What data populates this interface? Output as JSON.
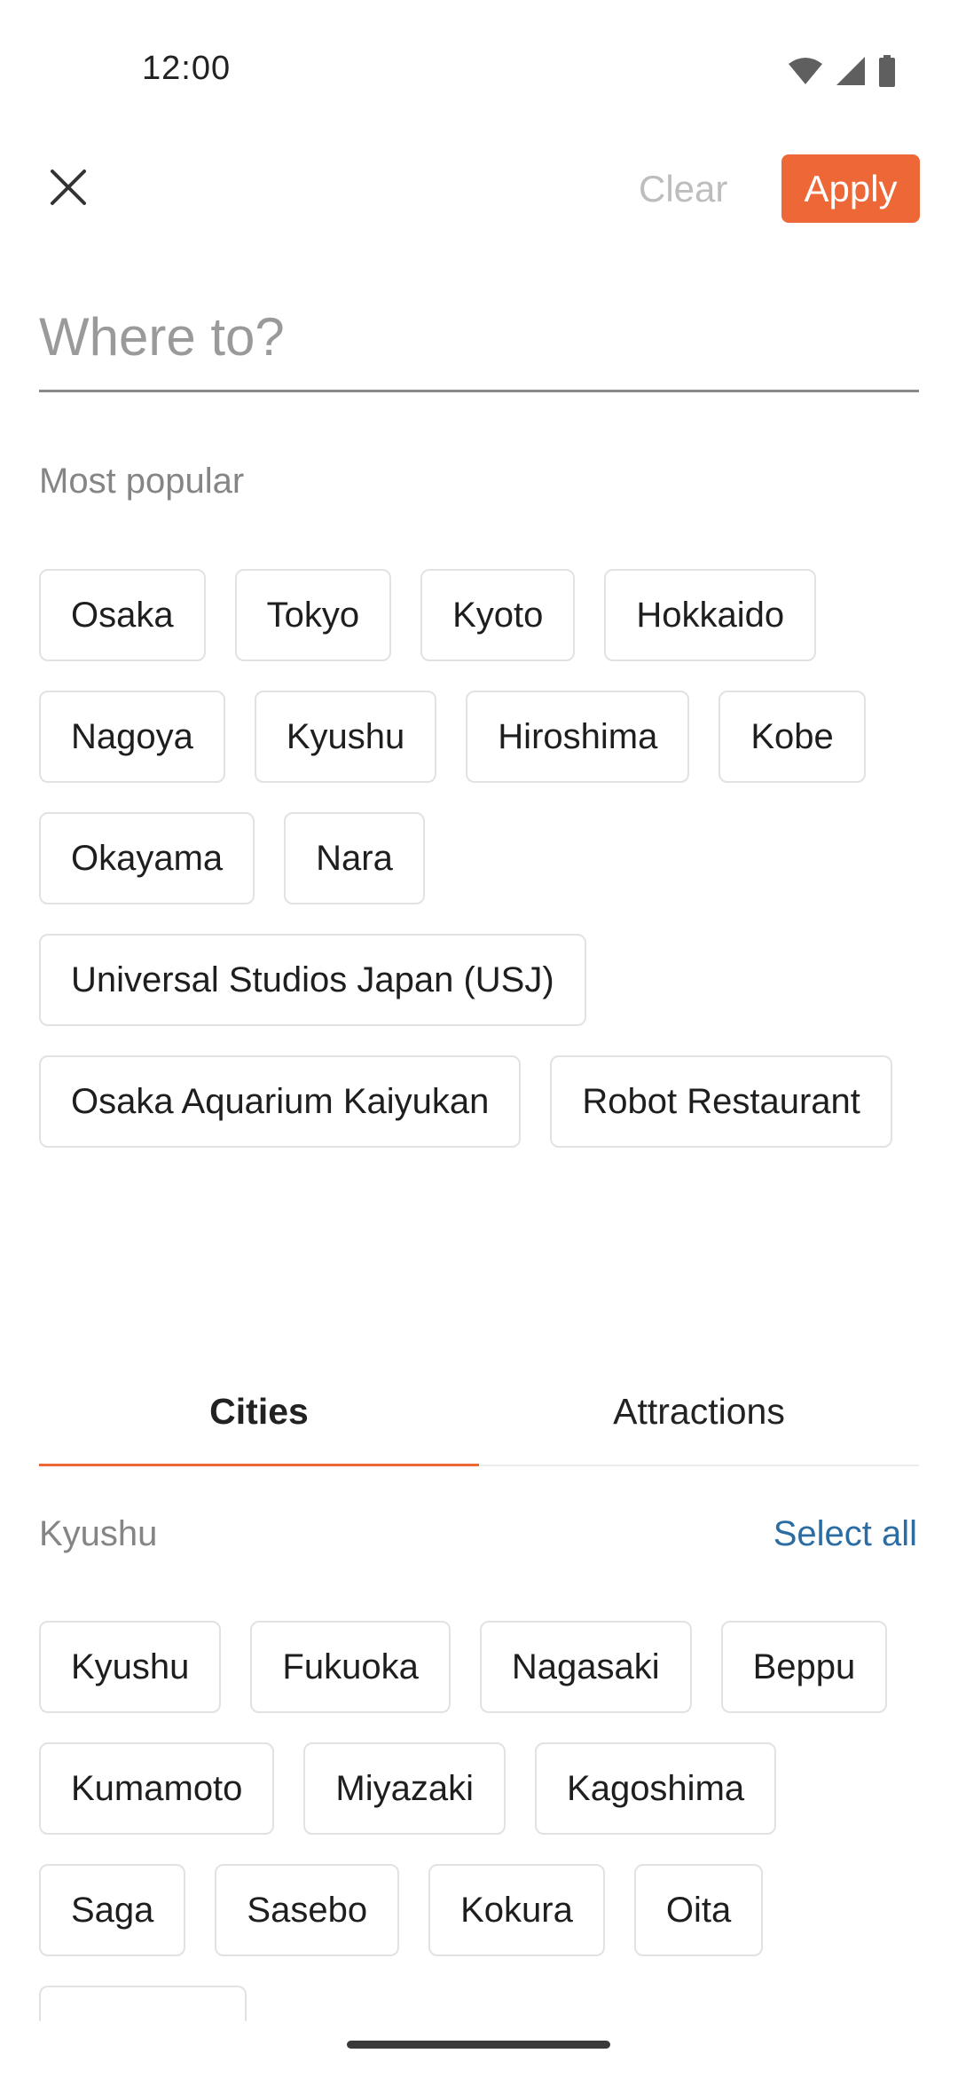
{
  "status_bar": {
    "time": "12:00",
    "icons": [
      "wifi-icon",
      "signal-icon",
      "battery-icon"
    ]
  },
  "header": {
    "close_icon": "close-icon",
    "clear_label": "Clear",
    "apply_label": "Apply"
  },
  "search": {
    "placeholder": "Where to?",
    "value": ""
  },
  "popular": {
    "label": "Most popular",
    "chips": [
      "Osaka",
      "Tokyo",
      "Kyoto",
      "Hokkaido",
      "Nagoya",
      "Kyushu",
      "Hiroshima",
      "Kobe",
      "Okayama",
      "Nara",
      "Universal Studios Japan (USJ)",
      "Osaka Aquarium Kaiyukan",
      "Robot Restaurant"
    ]
  },
  "tabs": [
    {
      "label": "Cities",
      "active": true
    },
    {
      "label": "Attractions",
      "active": false
    }
  ],
  "region": {
    "label": "Kyushu",
    "select_all_label": "Select all",
    "chips": [
      "Kyushu",
      "Fukuoka",
      "Nagasaki",
      "Beppu",
      "Kumamoto",
      "Miyazaki",
      "Kagoshima",
      "Saga",
      "Sasebo",
      "Kokura",
      "Oita"
    ]
  },
  "colors": {
    "accent": "#ee6737",
    "link": "#2b6ca3",
    "muted_text": "#858585",
    "chip_border": "#e2e2e2"
  }
}
